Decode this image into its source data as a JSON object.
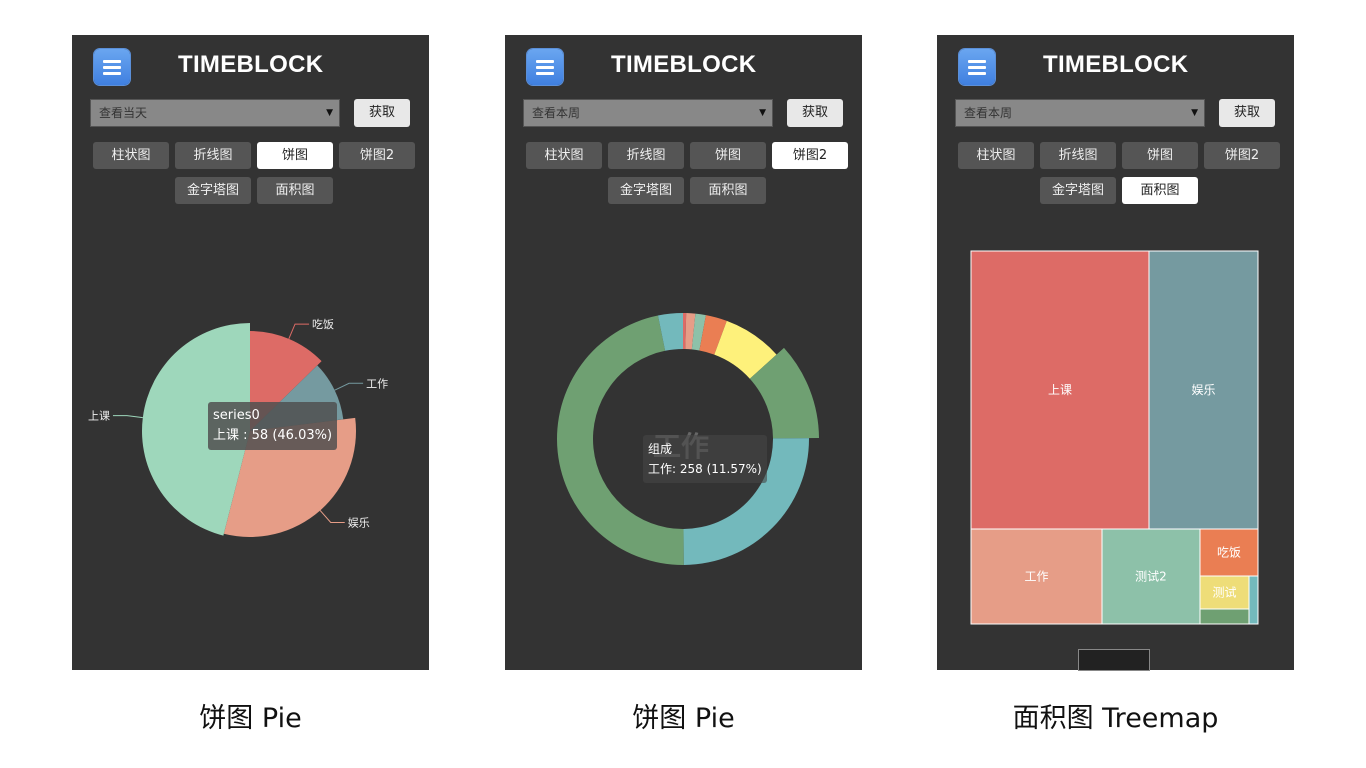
{
  "app_title": "TIMEBLOCK",
  "fetch_label": "获取",
  "tabs": {
    "bar": "柱状图",
    "line": "折线图",
    "pie": "饼图",
    "pie2": "饼图2",
    "pyramid": "金字塔图",
    "area": "面积图"
  },
  "panels": [
    {
      "range": "查看当天",
      "active_tab": "pie",
      "caption": "饼图 Pie",
      "tooltip_title": "series0",
      "tooltip_text": "上课 : 58 (46.03%)"
    },
    {
      "range": "查看本周",
      "active_tab": "pie2",
      "caption": "饼图 Pie",
      "tooltip_title": "组成",
      "tooltip_text": "工作: 258 (11.57%)",
      "center_label": "工作"
    },
    {
      "range": "查看本周",
      "active_tab": "area",
      "caption": "面积图 Treemap"
    }
  ],
  "chart_data": [
    {
      "type": "pie",
      "series": [
        {
          "name": "series0",
          "values": [
            16,
            13,
            39,
            58
          ]
        }
      ],
      "categories": [
        "吃饭",
        "工作",
        "娱乐",
        "上课"
      ],
      "colors": [
        "#dd6b66",
        "#759aa0",
        "#e69d87",
        "#9ed7bb"
      ]
    },
    {
      "type": "pie",
      "series": [
        {
          "name": "组成",
          "values": [
            9,
            26,
            30,
            61,
            171,
            258,
            558,
            1046,
            71
          ]
        }
      ],
      "categories": [
        "",
        "",
        "",
        "",
        "",
        "工作",
        "",
        "",
        ""
      ],
      "colors": [
        "#dd6b66",
        "#e69d87",
        "#8dc1a9",
        "#ea7e53",
        "#fef17b",
        "#6fa072",
        "#73b9bc",
        "#6fa072",
        "#73b9bc"
      ]
    },
    {
      "type": "treemap",
      "categories": [
        "上课",
        "娱乐",
        "工作",
        "测试2",
        "吃饭",
        "测试"
      ],
      "colors": [
        "#dd6b66",
        "#759aa0",
        "#e69d87",
        "#8dc1a9",
        "#ea7e53",
        "#eedd78"
      ]
    }
  ]
}
